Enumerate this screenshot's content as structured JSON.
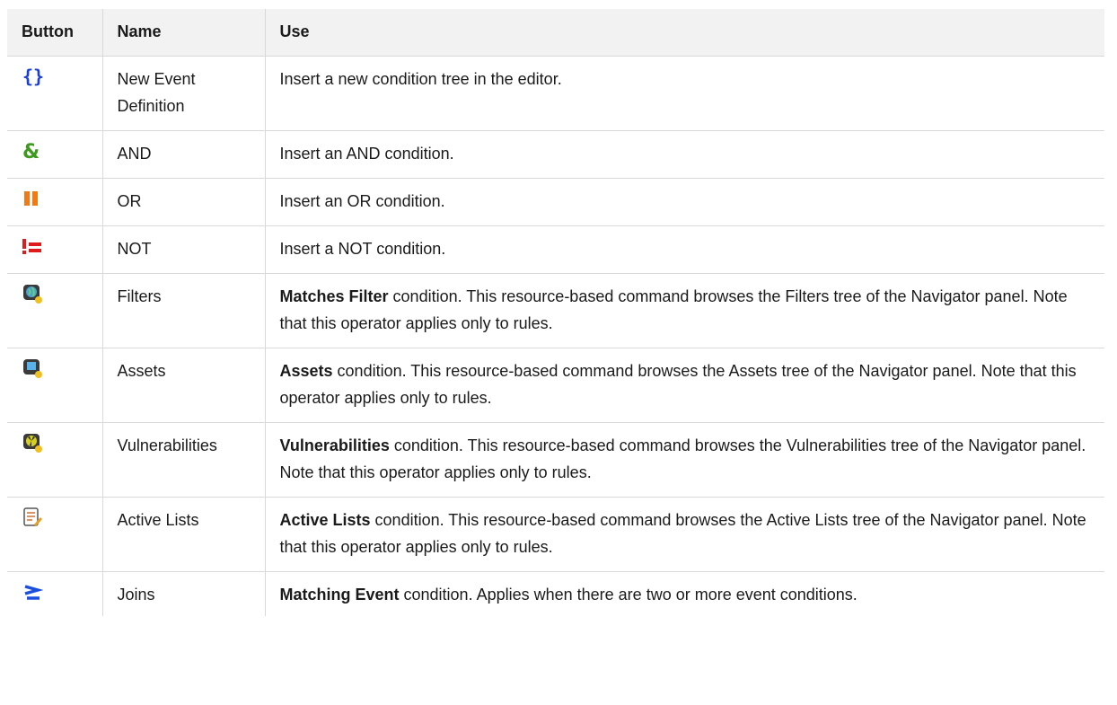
{
  "table": {
    "headers": {
      "button": "Button",
      "name": "Name",
      "use": "Use"
    },
    "rows": [
      {
        "icon": "curly-braces-icon",
        "name": "New Event Definition",
        "use_bold": "",
        "use": "Insert a new condition tree in the editor."
      },
      {
        "icon": "ampersand-icon",
        "name": "AND",
        "use_bold": "",
        "use": "Insert an AND condition."
      },
      {
        "icon": "double-bar-icon",
        "name": "OR",
        "use_bold": "",
        "use": "Insert an OR condition."
      },
      {
        "icon": "not-equal-icon",
        "name": "NOT",
        "use_bold": "",
        "use": "Insert a NOT condition."
      },
      {
        "icon": "filter-globe-icon",
        "name": "Filters",
        "use_bold": "Matches Filter",
        "use": " condition. This resource-based command browses the Filters tree of the Navigator panel. Note that this operator applies only to rules."
      },
      {
        "icon": "asset-monitor-icon",
        "name": "Assets",
        "use_bold": "Assets",
        "use": " condition. This resource-based command browses the Assets tree of the Navigator panel. Note that this operator applies only to rules."
      },
      {
        "icon": "vulnerability-icon",
        "name": "Vulnerabilities",
        "use_bold": "Vulnerabilities",
        "use": " condition. This resource-based command browses the Vulnerabilities tree of the Navigator panel. Note that this operator applies only to rules."
      },
      {
        "icon": "active-list-icon",
        "name": "Active Lists",
        "use_bold": "Active Lists",
        "use": " condition. This resource-based command browses the Active Lists tree of the Navigator panel. Note that this operator applies only to rules."
      },
      {
        "icon": "join-arrow-icon",
        "name": "Joins",
        "use_bold": "Matching Event",
        "use": " condition. Applies when there are two or more event conditions."
      }
    ]
  },
  "colors": {
    "header_bg": "#f2f2f2",
    "border": "#d9d9d9",
    "braces_blue": "#1a3fd6",
    "and_green": "#3e9a1e",
    "or_orange": "#f07a14",
    "not_red": "#e01b1b"
  }
}
